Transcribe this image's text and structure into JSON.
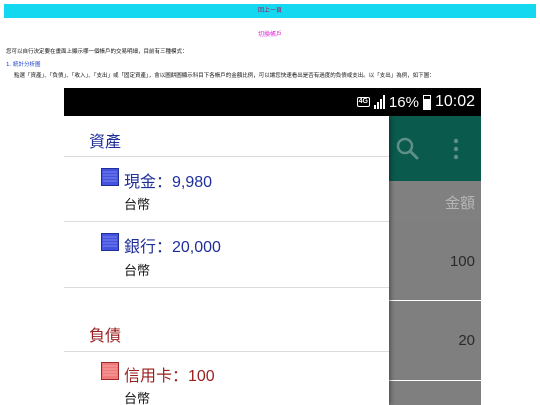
{
  "header": {
    "bar_text": "回上一頁",
    "switch_link": "切換帳戶"
  },
  "intro": "您可以自行決定要在畫面上顯示哪一個帳戶的交易明細，目前有三種模式：",
  "section_title": "1. 統計分析圖",
  "instructions": "點選「資產」、「負債」、「收入」、「支出」或「固定資產」，會以圖餅圖顯示科目下各帳戶的金額比例，可以讓您快速看出是否有過度的負債或支出。以「支出」為例，如下圖：",
  "phone": {
    "status": {
      "network": "4G",
      "battery_pct": "16%",
      "battery_level": 0.16,
      "time": "10:02"
    },
    "app": {
      "amount_header": "金額",
      "rows": [
        "100",
        "20"
      ]
    },
    "drawer": {
      "sections": [
        {
          "title": "資產",
          "accounts": [
            {
              "name": "現金：9,980",
              "currency": "台幣"
            },
            {
              "name": "銀行：20,000",
              "currency": "台幣"
            }
          ]
        },
        {
          "title": "負債",
          "accounts": [
            {
              "name": "信用卡：100",
              "currency": "台幣"
            }
          ]
        }
      ]
    }
  },
  "colors": {
    "top_bar": "#14d7f0",
    "link": "#e21bd6",
    "asset_blue": "#1f2f9a",
    "liability_red": "#9a1f1f"
  }
}
